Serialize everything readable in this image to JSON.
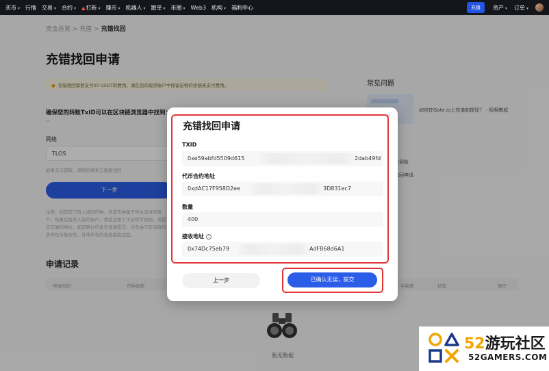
{
  "topnav": {
    "items": [
      {
        "label": "买币",
        "caret": true
      },
      {
        "label": "行情",
        "caret": false
      },
      {
        "label": "交易",
        "caret": true
      },
      {
        "label": "合约",
        "caret": true
      },
      {
        "label": "打新",
        "caret": true,
        "hot": true
      },
      {
        "label": "赚币",
        "caret": true
      },
      {
        "label": "机器人",
        "caret": true
      },
      {
        "label": "跟单",
        "caret": true
      },
      {
        "label": "币圈",
        "caret": true
      },
      {
        "label": "Web3",
        "caret": false
      },
      {
        "label": "机构",
        "caret": true
      },
      {
        "label": "福利中心",
        "caret": false
      }
    ],
    "deposit_label": "充值",
    "assets_label": "资产",
    "orders_label": "订单"
  },
  "breadcrumb": {
    "item1": "资金总览",
    "item2": "充值",
    "current": "充错找回"
  },
  "page_title": "充错找回申请",
  "notice": "充错找回需要支付20 USDT的费用，请在您的现货账户中保留足够的余额来支付费用。",
  "form": {
    "ensure_text": "确保您的转账TxID可以在区块链浏览器中找到：",
    "dash": "--",
    "network_label": "网络",
    "network_value": "TLOS",
    "hint": "如果无法提取，请稍后联系方客服找回",
    "next_label": "下一步",
    "note": "注意：如您提了链上找回币种，且该币种属于平台支持的资产，恢复后将存入您的账户。请您注意了平台转币规则，请提交正确的地址，如您确认信息无误请提交，涉及由于区块链的多样性与复杂性，并非所有的充值都能找回。"
  },
  "faq": {
    "title": "常见问题",
    "link1": "如何在Gate.io上充值和提现？ - 视频教程",
    "link2": "未到账",
    "link3": "找回申请"
  },
  "records": {
    "title": "申请记录",
    "columns": [
      "申请时间",
      "币种名称",
      "手续费",
      "状态",
      "操作"
    ],
    "empty_text": "暂无数据"
  },
  "modal": {
    "title": "充错找回申请",
    "fields": [
      {
        "label": "TXID",
        "value_start": "0xe59abfd5509d615",
        "value_end": "2dab49fd"
      },
      {
        "label": "代币合约地址",
        "value_start": "0xdAC17F958D2ee",
        "value_end": "3D831ec7"
      },
      {
        "label": "数量",
        "value_start": "400",
        "value_end": ""
      },
      {
        "label": "接收地址",
        "value_start": "0x74Dc75eb79",
        "value_end": "AdFB68d6A1"
      }
    ],
    "info_icon": "i",
    "prev_label": "上一步",
    "submit_label": "已确认无误，提交",
    "close_icon": "✕"
  },
  "watermark": {
    "brand_num": "52",
    "brand_text": "游玩社区",
    "domain": "52GAMERS.COM"
  },
  "colors": {
    "accent": "#2b5de8",
    "highlight": "#e23434",
    "nav_bg": "#14161c"
  }
}
